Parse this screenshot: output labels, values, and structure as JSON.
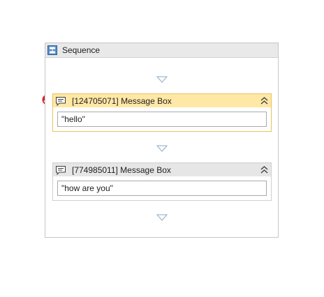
{
  "sequence": {
    "title": "Sequence",
    "icon": "sequence-icon"
  },
  "activities": [
    {
      "title": "[124705071] Message Box",
      "icon": "message-box-icon",
      "value": "\"hello\"",
      "selected": true,
      "has_error": true
    },
    {
      "title": "[774985011] Message Box",
      "icon": "message-box-icon",
      "value": "\"how are you\"",
      "selected": false,
      "has_error": false
    }
  ],
  "colors": {
    "selected_header": "#ffe8a6",
    "selected_border": "#e6c35c",
    "header": "#e6e6e6",
    "error": "#d9232e",
    "drop_arrow": "#8fa9c6"
  }
}
